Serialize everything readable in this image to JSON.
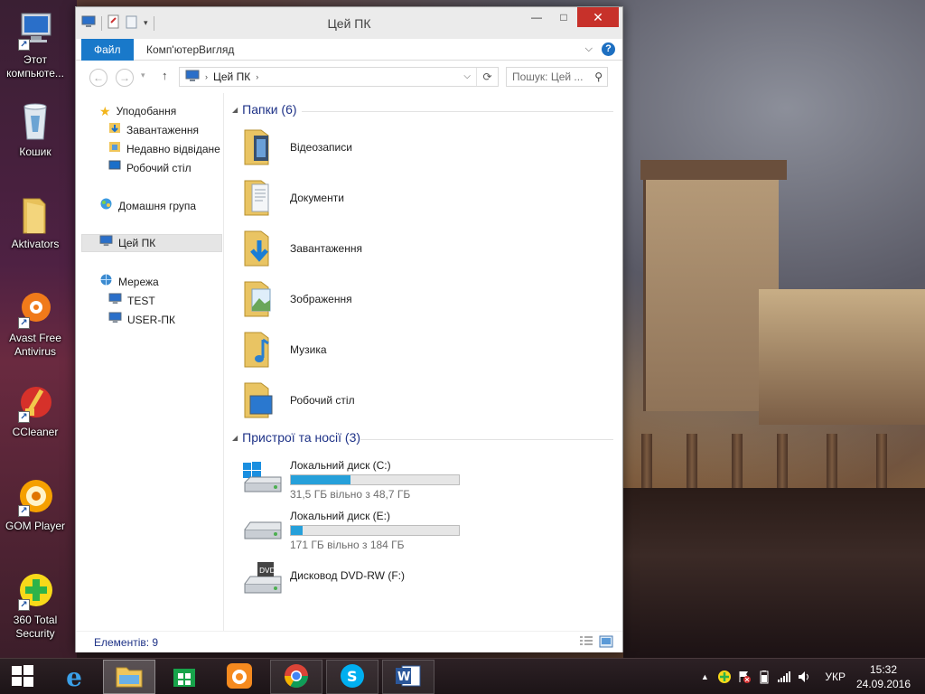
{
  "window": {
    "title": "Цей ПК",
    "tabs": [
      "Файл",
      "Комп'ютер",
      "Вигляд"
    ],
    "min_label": "—",
    "max_label": "□",
    "close_label": "✕",
    "expand_ribbon": "⌵",
    "help": "?"
  },
  "address": {
    "path": "Цей ПК",
    "search_placeholder": "Пошук: Цей ..."
  },
  "nav": {
    "favorites": "Уподобання",
    "downloads": "Завантаження",
    "recent": "Недавно відвідане",
    "desktop": "Робочий стіл",
    "homegroup": "Домашня група",
    "this_pc": "Цей ПК",
    "network": "Мережа",
    "test": "TEST",
    "user_pc": "USER-ПК"
  },
  "folders": {
    "header": "Папки (6)",
    "items": [
      "Відеозаписи",
      "Документи",
      "Завантаження",
      "Зображення",
      "Музика",
      "Робочий стіл"
    ]
  },
  "devices": {
    "header": "Пристрої та носії (3)",
    "items": [
      {
        "name": "Локальний диск (C:)",
        "free": "31,5 ГБ вільно з 48,7 ГБ",
        "used_fraction": 0.353
      },
      {
        "name": "Локальний диск (E:)",
        "free": "171 ГБ вільно з 184 ГБ",
        "used_fraction": 0.071
      },
      {
        "name": "Дисковод DVD-RW (F:)"
      }
    ]
  },
  "status": {
    "count": "Елементів: 9"
  },
  "desktop_icons": [
    "Этот компьюте...",
    "Кошик",
    "Aktivators",
    "Avast Free Antivirus",
    "CCleaner",
    "GOM Player",
    "360 Total Security"
  ],
  "taskbar": {
    "language": "УКР",
    "time": "15:32",
    "date": "24.09.2016"
  },
  "colors": {
    "accent": "#1979ca",
    "link": "#1e3287",
    "disk_bar": "#26a0da",
    "close_button": "#c7312a"
  }
}
